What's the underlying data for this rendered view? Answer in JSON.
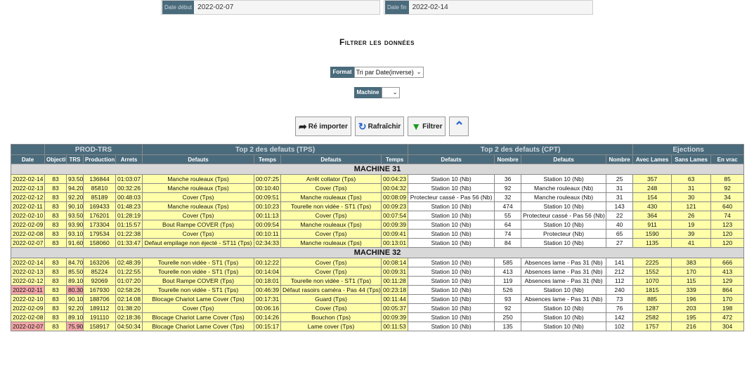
{
  "dates": {
    "start_label": "Date début",
    "start_value": "2022-02-07",
    "end_label": "Date fin",
    "end_value": "2022-02-14"
  },
  "title": "Filtrer les données",
  "format": {
    "label": "Format",
    "value": "Tri par Date(inverse)"
  },
  "machine": {
    "label": "Machine",
    "value": ""
  },
  "buttons": {
    "reimport": "Ré importer",
    "refresh": "Rafraîchir",
    "filter": "Filtrer"
  },
  "groups": [
    "PROD-TRS",
    "Top 2 des defauts (TPS)",
    "Top 2 des defauts (CPT)",
    "Ejections"
  ],
  "headers": [
    "Date",
    "Objectif",
    "TRS",
    "Production",
    "Arrets",
    "Defauts",
    "Temps",
    "Defauts",
    "Temps",
    "Defauts",
    "Nombre",
    "Defauts",
    "Nombre",
    "Avec Lames",
    "Sans Lames",
    "En vrac"
  ],
  "sections": [
    {
      "name": "MACHINE 31",
      "rows": [
        {
          "date": "2022-02-14",
          "obj": "83",
          "trs": "93.50",
          "prod": "136844",
          "arrets": "01:03:07",
          "d1": "Manche rouleaux (Tps)",
          "t1": "00:07:25",
          "d2": "Arrêt collator (Tps)",
          "t2": "00:04:23",
          "c1": "Station 10 (Nb)",
          "n1": "36",
          "c2": "Station 10 (Nb)",
          "n2": "25",
          "avec": "357",
          "sans": "63",
          "vrac": "85",
          "alert": false
        },
        {
          "date": "2022-02-13",
          "obj": "83",
          "trs": "94.20",
          "prod": "85810",
          "arrets": "00:32:26",
          "d1": "Manche rouleaux (Tps)",
          "t1": "00:10:40",
          "d2": "Cover (Tps)",
          "t2": "00:04:32",
          "c1": "Station 10 (Nb)",
          "n1": "92",
          "c2": "Manche rouleaux (Nb)",
          "n2": "31",
          "avec": "248",
          "sans": "31",
          "vrac": "92",
          "alert": false
        },
        {
          "date": "2022-02-12",
          "obj": "83",
          "trs": "92.20",
          "prod": "85189",
          "arrets": "00:48:03",
          "d1": "Cover (Tps)",
          "t1": "00:09:51",
          "d2": "Manche rouleaux (Tps)",
          "t2": "00:08:09",
          "c1": "Protecteur cassé - Pas 56 (Nb)",
          "n1": "32",
          "c2": "Manche rouleaux (Nb)",
          "n2": "31",
          "avec": "154",
          "sans": "30",
          "vrac": "34",
          "alert": false
        },
        {
          "date": "2022-02-11",
          "obj": "83",
          "trs": "90.10",
          "prod": "169433",
          "arrets": "01:48:23",
          "d1": "Manche rouleaux (Tps)",
          "t1": "00:10:23",
          "d2": "Tourelle non vidée - ST1 (Tps)",
          "t2": "00:09:23",
          "c1": "Station 10 (Nb)",
          "n1": "474",
          "c2": "Station 10 (Nb)",
          "n2": "143",
          "avec": "430",
          "sans": "121",
          "vrac": "640",
          "alert": false
        },
        {
          "date": "2022-02-10",
          "obj": "83",
          "trs": "93.50",
          "prod": "176201",
          "arrets": "01:28:19",
          "d1": "Cover (Tps)",
          "t1": "00:11:13",
          "d2": "Cover (Tps)",
          "t2": "00:07:54",
          "c1": "Station 10 (Nb)",
          "n1": "55",
          "c2": "Protecteur cassé - Pas 56 (Nb)",
          "n2": "22",
          "avec": "364",
          "sans": "26",
          "vrac": "74",
          "alert": false
        },
        {
          "date": "2022-02-09",
          "obj": "83",
          "trs": "93.90",
          "prod": "173304",
          "arrets": "01:15:57",
          "d1": "Bout Rampe COVER (Tps)",
          "t1": "00:09:54",
          "d2": "Manche rouleaux (Tps)",
          "t2": "00:09:39",
          "c1": "Station 10 (Nb)",
          "n1": "64",
          "c2": "Station 10 (Nb)",
          "n2": "40",
          "avec": "911",
          "sans": "19",
          "vrac": "123",
          "alert": false
        },
        {
          "date": "2022-02-08",
          "obj": "83",
          "trs": "93.10",
          "prod": "179534",
          "arrets": "01:22:38",
          "d1": "Cover (Tps)",
          "t1": "00:10:11",
          "d2": "Cover (Tps)",
          "t2": "00:09:41",
          "c1": "Station 10 (Nb)",
          "n1": "74",
          "c2": "Protecteur (Nb)",
          "n2": "65",
          "avec": "1590",
          "sans": "39",
          "vrac": "120",
          "alert": false
        },
        {
          "date": "2022-02-07",
          "obj": "83",
          "trs": "91.60",
          "prod": "158060",
          "arrets": "01:33:47",
          "d1": "Defaut empilage non éjecté - ST11 (Tps)",
          "t1": "02:34:33",
          "d2": "Manche rouleaux (Tps)",
          "t2": "00:13:01",
          "c1": "Station 10 (Nb)",
          "n1": "84",
          "c2": "Station 10 (Nb)",
          "n2": "27",
          "avec": "1135",
          "sans": "41",
          "vrac": "120",
          "alert": false
        }
      ]
    },
    {
      "name": "MACHINE 32",
      "rows": [
        {
          "date": "2022-02-14",
          "obj": "83",
          "trs": "84.70",
          "prod": "163206",
          "arrets": "02:48:39",
          "d1": "Tourelle non vidée - ST1 (Tps)",
          "t1": "00:12:22",
          "d2": "Cover (Tps)",
          "t2": "00:08:14",
          "c1": "Station 10 (Nb)",
          "n1": "585",
          "c2": "Absences lame - Pas 31 (Nb)",
          "n2": "141",
          "avec": "2225",
          "sans": "383",
          "vrac": "666",
          "alert": false
        },
        {
          "date": "2022-02-13",
          "obj": "83",
          "trs": "85.50",
          "prod": "85224",
          "arrets": "01:22:55",
          "d1": "Tourelle non vidée - ST1 (Tps)",
          "t1": "00:14:04",
          "d2": "Cover (Tps)",
          "t2": "00:09:31",
          "c1": "Station 10 (Nb)",
          "n1": "413",
          "c2": "Absences lame - Pas 31 (Nb)",
          "n2": "212",
          "avec": "1552",
          "sans": "170",
          "vrac": "413",
          "alert": false
        },
        {
          "date": "2022-02-12",
          "obj": "83",
          "trs": "89.10",
          "prod": "92069",
          "arrets": "01:07:20",
          "d1": "Bout Rampe COVER (Tps)",
          "t1": "00:18:01",
          "d2": "Tourelle non vidée - ST1 (Tps)",
          "t2": "00:11:28",
          "c1": "Station 10 (Nb)",
          "n1": "119",
          "c2": "Absences lame - Pas 31 (Nb)",
          "n2": "112",
          "avec": "1070",
          "sans": "115",
          "vrac": "129",
          "alert": false
        },
        {
          "date": "2022-02-11",
          "obj": "83",
          "trs": "80.30",
          "prod": "167930",
          "arrets": "02:58:26",
          "d1": "Tourelle non vidée - ST1 (Tps)",
          "t1": "00:46:39",
          "d2": "Défaut rasoirs caméra - Pas 44 (Tps)",
          "t2": "00:23:18",
          "c1": "Station 10 (Nb)",
          "n1": "526",
          "c2": "Station 10 (Nb)",
          "n2": "240",
          "avec": "1815",
          "sans": "339",
          "vrac": "864",
          "alert": true
        },
        {
          "date": "2022-02-10",
          "obj": "83",
          "trs": "90.10",
          "prod": "188706",
          "arrets": "02:14:08",
          "d1": "Blocage Chariot Lame Cover (Tps)",
          "t1": "00:17:31",
          "d2": "Guard (Tps)",
          "t2": "00:11:44",
          "c1": "Station 10 (Nb)",
          "n1": "93",
          "c2": "Absences lame - Pas 31 (Nb)",
          "n2": "73",
          "avec": "885",
          "sans": "196",
          "vrac": "170",
          "alert": false
        },
        {
          "date": "2022-02-09",
          "obj": "83",
          "trs": "92.20",
          "prod": "189112",
          "arrets": "01:38:20",
          "d1": "Cover (Tps)",
          "t1": "00:06:16",
          "d2": "Cover (Tps)",
          "t2": "00:05:37",
          "c1": "Station 10 (Nb)",
          "n1": "92",
          "c2": "Station 10 (Nb)",
          "n2": "76",
          "avec": "1287",
          "sans": "203",
          "vrac": "198",
          "alert": false
        },
        {
          "date": "2022-02-08",
          "obj": "83",
          "trs": "89.10",
          "prod": "191110",
          "arrets": "02:18:36",
          "d1": "Blocage Chariot Lame Cover (Tps)",
          "t1": "00:14:26",
          "d2": "Bouchon (Tps)",
          "t2": "00:09:39",
          "c1": "Station 10 (Nb)",
          "n1": "250",
          "c2": "Station 10 (Nb)",
          "n2": "142",
          "avec": "2582",
          "sans": "195",
          "vrac": "472",
          "alert": false
        },
        {
          "date": "2022-02-07",
          "obj": "83",
          "trs": "75.90",
          "prod": "158917",
          "arrets": "04:50:34",
          "d1": "Blocage Chariot Lame Cover (Tps)",
          "t1": "00:15:17",
          "d2": "Lame cover (Tps)",
          "t2": "00:11:53",
          "c1": "Station 10 (Nb)",
          "n1": "135",
          "c2": "Station 10 (Nb)",
          "n2": "102",
          "avec": "1757",
          "sans": "216",
          "vrac": "304",
          "alert": true
        }
      ]
    }
  ]
}
